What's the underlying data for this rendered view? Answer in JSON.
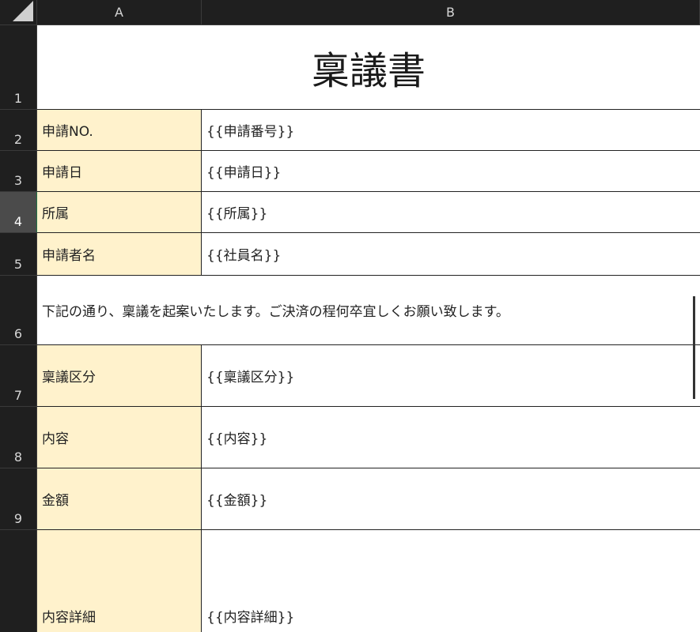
{
  "columns": [
    "A",
    "B"
  ],
  "rows": [
    "1",
    "2",
    "3",
    "4",
    "5",
    "6",
    "7",
    "8",
    "9",
    ""
  ],
  "title": "稟議書",
  "fields": [
    {
      "label": "申請NO.",
      "value": "{{申請番号}}"
    },
    {
      "label": "申請日",
      "value": "{{申請日}}"
    },
    {
      "label": "所属",
      "value": "{{所属}}"
    },
    {
      "label": "申請者名",
      "value": "{{社員名}}"
    }
  ],
  "note": "下記の通り、稟議を起案いたします。ご決済の程何卒宜しくお願い致します。",
  "fields2": [
    {
      "label": "稟議区分",
      "value": "{{稟議区分}}"
    },
    {
      "label": "内容",
      "value": "{{内容}}"
    },
    {
      "label": "金額",
      "value": "{{金額}}"
    },
    {
      "label": "内容詳細",
      "value": "{{内容詳細}}"
    }
  ],
  "colors": {
    "label_fill": "#fff2cc",
    "header_bg": "#1f1f1f",
    "active_row": "#4b4b4b"
  }
}
